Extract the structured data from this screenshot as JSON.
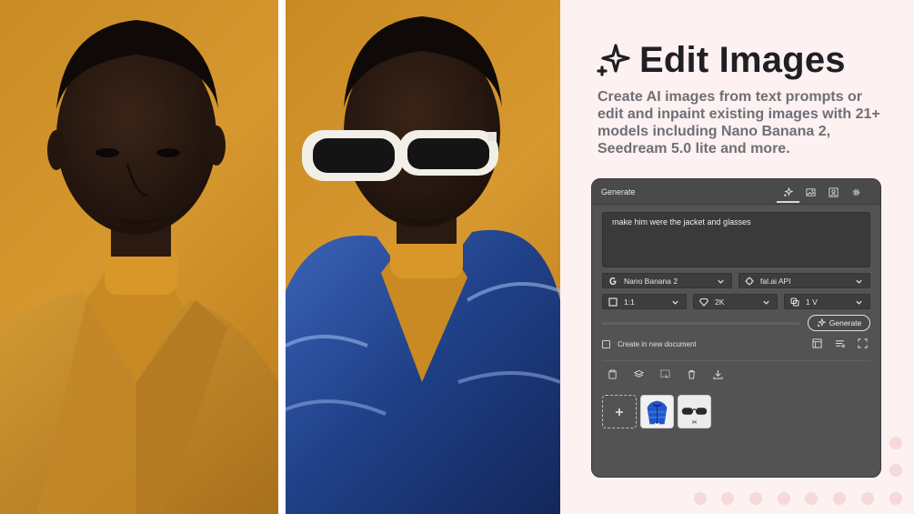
{
  "hero": {
    "title": "Edit Images",
    "description": "Create AI images from text prompts or edit and inpaint existing images with 21+ models including Nano Banana 2, Seedream 5.0 lite and more."
  },
  "panel": {
    "title": "Generate",
    "tabs": [
      {
        "icon": "sparkle-icon",
        "active": true
      },
      {
        "icon": "image-edit-icon",
        "active": false
      },
      {
        "icon": "person-frame-icon",
        "active": false
      },
      {
        "icon": "gear-icon",
        "active": false
      }
    ],
    "prompt": "make him were the jacket and glasses",
    "model": {
      "label": "Nano Banana 2",
      "icon": "google-g-icon"
    },
    "provider": {
      "label": "fal.ai API",
      "icon": "provider-icon"
    },
    "aspect_ratio": {
      "label": "1:1",
      "icon": "square-icon"
    },
    "resolution": {
      "label": "2K",
      "icon": "diamond-icon"
    },
    "variations": {
      "label": "1 V",
      "icon": "copies-icon"
    },
    "generate_label": "Generate",
    "create_new_doc_label": "Create in new document",
    "create_new_doc_checked": false
  },
  "colors": {
    "background": "#fdf1f1",
    "panel": "#535353",
    "photo_backdrop": "#d1922a",
    "jacket_blue": "#1f3f86"
  }
}
